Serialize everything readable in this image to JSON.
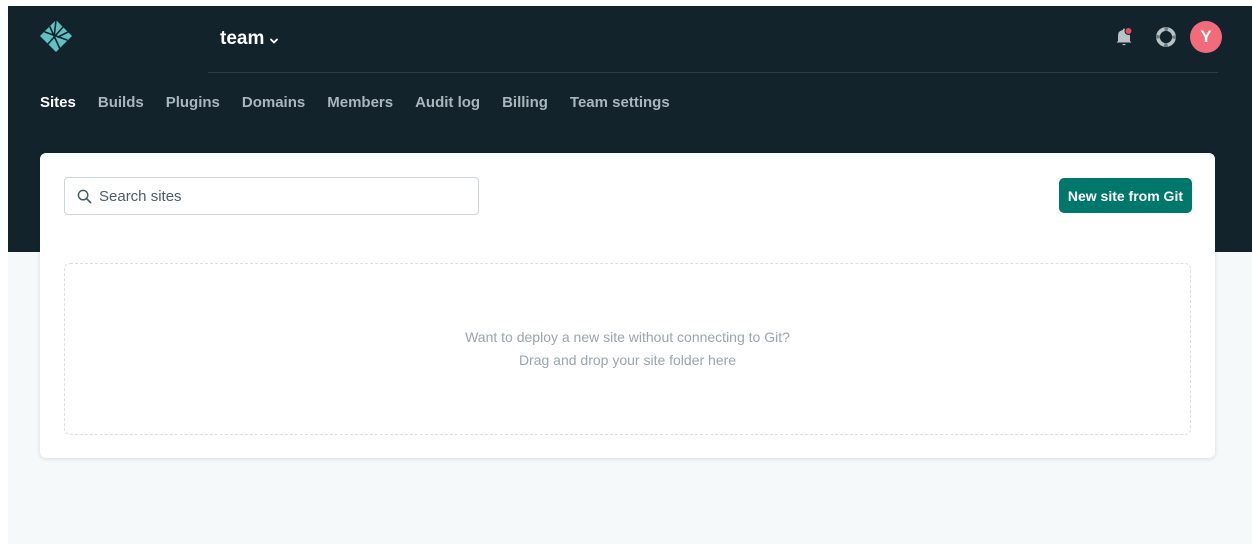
{
  "header": {
    "team_name": "team",
    "avatar_initial": "Y",
    "icons": {
      "logo": "netlify-logo-icon",
      "team_menu": "chevron-down-icon",
      "notifications": "bell-icon",
      "help": "lifebuoy-icon"
    },
    "notification_dot_color": "#e64b5c"
  },
  "nav": {
    "tabs": [
      {
        "label": "Sites",
        "active": true
      },
      {
        "label": "Builds"
      },
      {
        "label": "Plugins"
      },
      {
        "label": "Domains"
      },
      {
        "label": "Members"
      },
      {
        "label": "Audit log"
      },
      {
        "label": "Billing"
      },
      {
        "label": "Team settings"
      }
    ]
  },
  "sites": {
    "search": {
      "placeholder": "Search sites",
      "value": "",
      "icon": "search-icon"
    },
    "new_site_label": "New site from Git",
    "dropzone": {
      "line1": "Want to deploy a new site without connecting to Git?",
      "line2": "Drag and drop your site folder here"
    }
  },
  "colors": {
    "header_bg": "#13232b",
    "page_bg": "#f6f9fa",
    "accent": "#00776b",
    "avatar": "#f16b7a",
    "logo": "#5ec2c4"
  }
}
